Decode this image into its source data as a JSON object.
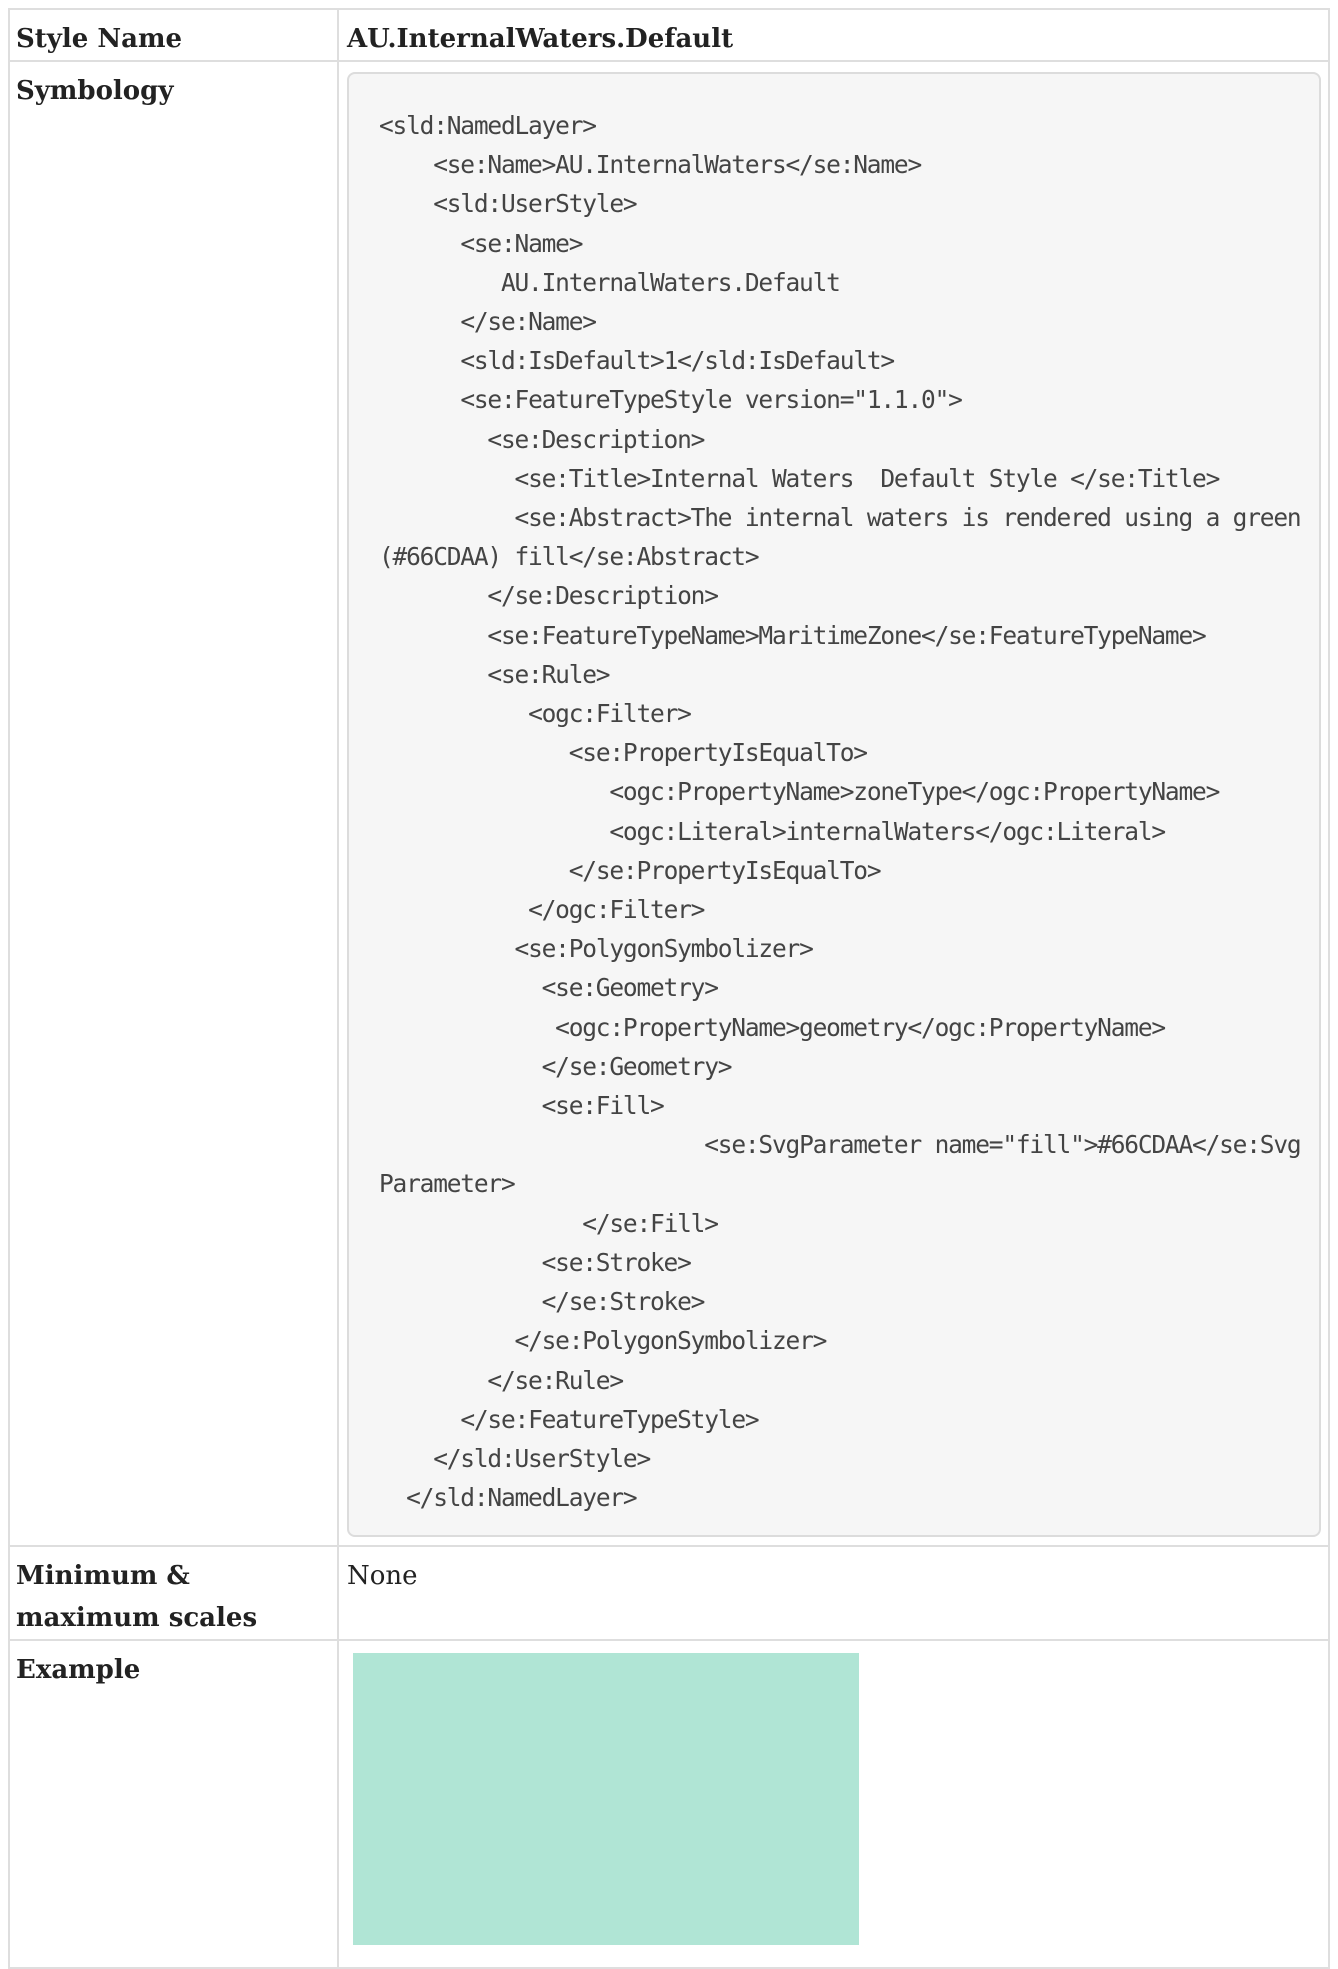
{
  "rows": {
    "style_name": {
      "label": "Style Name",
      "value": "AU.InternalWaters.Default"
    },
    "symbology": {
      "label": "Symbology",
      "code": "<sld:NamedLayer>\n    <se:Name>AU.InternalWaters</se:Name>\n    <sld:UserStyle>\n      <se:Name>\n         AU.InternalWaters.Default\n      </se:Name>\n      <sld:IsDefault>1</sld:IsDefault>\n      <se:FeatureTypeStyle version=\"1.1.0\">\n        <se:Description>\n          <se:Title>Internal Waters  Default Style </se:Title>\n          <se:Abstract>The internal waters is rendered using a green (#66CDAA) fill</se:Abstract>\n        </se:Description>\n        <se:FeatureTypeName>MaritimeZone</se:FeatureTypeName>\n        <se:Rule>\n           <ogc:Filter>\n              <se:PropertyIsEqualTo>\n                 <ogc:PropertyName>zoneType</ogc:PropertyName>\n                 <ogc:Literal>internalWaters</ogc:Literal>\n              </se:PropertyIsEqualTo>\n           </ogc:Filter>\n          <se:PolygonSymbolizer>\n            <se:Geometry>\n             <ogc:PropertyName>geometry</ogc:PropertyName>\n            </se:Geometry>\n            <se:Fill>\n                        <se:SvgParameter name=\"fill\">#66CDAA</se:SvgParameter>\n               </se:Fill>\n            <se:Stroke>\n            </se:Stroke>\n          </se:PolygonSymbolizer>\n        </se:Rule>\n      </se:FeatureTypeStyle>\n    </sld:UserStyle>\n  </sld:NamedLayer>"
    },
    "scales": {
      "label": "Minimum & maximum scales",
      "value": "None"
    },
    "example": {
      "label": "Example",
      "swatch_color": "#B0E5D5"
    }
  }
}
